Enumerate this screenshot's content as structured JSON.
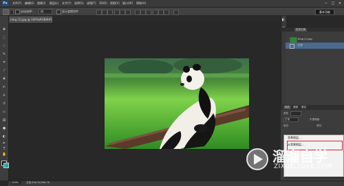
{
  "app": {
    "logo": "Ps",
    "menu": [
      "文件(F)",
      "编辑(E)",
      "图像(I)",
      "图层(L)",
      "文字(Y)",
      "选择(S)",
      "滤镜(T)",
      "3D(D)",
      "视图(V)",
      "窗口(W)",
      "帮助(H)"
    ],
    "window_controls": [
      "−",
      "□",
      "×"
    ]
  },
  "options": {
    "auto_select_label": "自动选择：",
    "auto_select_value": "组",
    "transform_label": "显示变换控件",
    "workspace": "基本功能"
  },
  "document": {
    "tab_title": "timg (1).jpg @ 100%(RGB/8#)"
  },
  "history_panel": {
    "tabs": [
      "历史记录"
    ],
    "items": [
      {
        "label": "timg (1).jpg"
      },
      {
        "label": "打开"
      }
    ]
  },
  "layers_panel": {
    "tabs": [
      "图层",
      "通道",
      "路径"
    ],
    "kind_label": "类型",
    "mode_value": "正常",
    "opacity_label": "不透明度：",
    "lock_label": "锁定：",
    "fill_label": "填充："
  },
  "context_menu": {
    "items": [
      {
        "label": "背景图层..."
      },
      {
        "label": "从背景图层..."
      }
    ]
  },
  "status": {
    "zoom": "100%",
    "doc_info": "文档:398.7K/398.7K"
  },
  "watermark": {
    "brand": "溜溜自学",
    "url": "ZIXUE.3D66.COM"
  },
  "colors": {
    "foreground": "#000000",
    "background": "#2aa8a8",
    "history_selected": "#4a6a90",
    "highlight_border": "#e02020"
  }
}
